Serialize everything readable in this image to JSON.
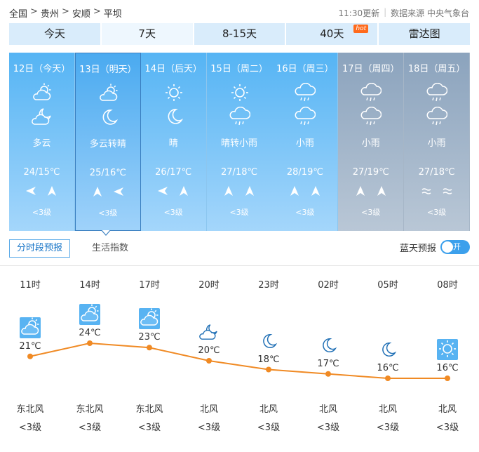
{
  "breadcrumb": {
    "items": [
      "全国",
      "贵州",
      "安顺",
      "平坝"
    ],
    "sep": ">"
  },
  "meta": {
    "updated": "11:30更新",
    "source": "数据来源 中央气象台"
  },
  "tabs": [
    {
      "label": "今天"
    },
    {
      "label": "7天"
    },
    {
      "label": "8-15天"
    },
    {
      "label": "40天",
      "badge": "hot"
    },
    {
      "label": "雷达图"
    }
  ],
  "days": [
    {
      "date": "12日（今天）",
      "icon_day": "partly-cloudy-icon",
      "icon_night": "cloudy-night-icon",
      "desc": "多云",
      "temp": "24/15℃",
      "wind_level": "<3级",
      "wind_dirs": [
        "northeast",
        "southwest"
      ],
      "style": "blue"
    },
    {
      "date": "13日（明天）",
      "icon_day": "partly-cloudy-icon",
      "icon_night": "moon-icon",
      "desc": "多云转晴",
      "temp": "25/16℃",
      "wind_level": "<3级",
      "wind_dirs": [
        "southwest",
        "northeast"
      ],
      "style": "selected"
    },
    {
      "date": "14日（后天）",
      "icon_day": "sun-icon",
      "icon_night": "moon-icon",
      "desc": "晴",
      "temp": "26/17℃",
      "wind_level": "<3级",
      "wind_dirs": [
        "northeast",
        "southwest"
      ],
      "style": "blue"
    },
    {
      "date": "15日（周二）",
      "icon_day": "sun-icon",
      "icon_night": "rain-icon",
      "desc": "晴转小雨",
      "temp": "27/18℃",
      "wind_level": "<3级",
      "wind_dirs": [
        "southwest",
        "southwest"
      ],
      "style": "blue"
    },
    {
      "date": "16日（周三）",
      "icon_day": "rain-icon",
      "icon_night": "rain-icon",
      "desc": "小雨",
      "temp": "28/19℃",
      "wind_level": "<3级",
      "wind_dirs": [
        "southwest",
        "southwest"
      ],
      "style": "blue"
    },
    {
      "date": "17日（周四）",
      "icon_day": "rain-icon",
      "icon_night": "rain-icon",
      "desc": "小雨",
      "temp": "27/19℃",
      "wind_level": "<3级",
      "wind_dirs": [
        "southwest",
        "southwest"
      ],
      "style": "gray"
    },
    {
      "date": "18日（周五）",
      "icon_day": "rain-icon",
      "icon_night": "rain-icon",
      "desc": "小雨",
      "temp": "27/18℃",
      "wind_level": "<3级",
      "wind_dirs": [
        "calm",
        "calm"
      ],
      "style": "gray"
    }
  ],
  "subtabs": [
    {
      "label": "分时段预报"
    },
    {
      "label": "生活指数"
    }
  ],
  "bluesky": {
    "label": "蓝天预报",
    "toggle": "开"
  },
  "hourly": [
    {
      "time": "11时",
      "icon": "partly-cloudy-icon",
      "temp": "21℃",
      "temp_value": 21,
      "wind": "东北风",
      "level": "<3级"
    },
    {
      "time": "14时",
      "icon": "partly-cloudy-icon",
      "temp": "24℃",
      "temp_value": 24,
      "wind": "东北风",
      "level": "<3级"
    },
    {
      "time": "17时",
      "icon": "partly-cloudy-icon",
      "temp": "23℃",
      "temp_value": 23,
      "wind": "东北风",
      "level": "<3级"
    },
    {
      "time": "20时",
      "icon": "cloudy-night-icon",
      "temp": "20℃",
      "temp_value": 20,
      "wind": "北风",
      "level": "<3级"
    },
    {
      "time": "23时",
      "icon": "moon-icon",
      "temp": "18℃",
      "temp_value": 18,
      "wind": "北风",
      "level": "<3级"
    },
    {
      "time": "02时",
      "icon": "moon-icon",
      "temp": "17℃",
      "temp_value": 17,
      "wind": "北风",
      "level": "<3级"
    },
    {
      "time": "05时",
      "icon": "moon-icon",
      "temp": "16℃",
      "temp_value": 16,
      "wind": "北风",
      "level": "<3级"
    },
    {
      "time": "08时",
      "icon": "sun-icon",
      "temp": "16℃",
      "temp_value": 16,
      "wind": "北风",
      "level": "<3级"
    }
  ],
  "colors": {
    "accent": "#3ca0ec",
    "line": "#f08a24",
    "day_blue": "#55b4f4",
    "day_gray": "#8ba3bd"
  }
}
